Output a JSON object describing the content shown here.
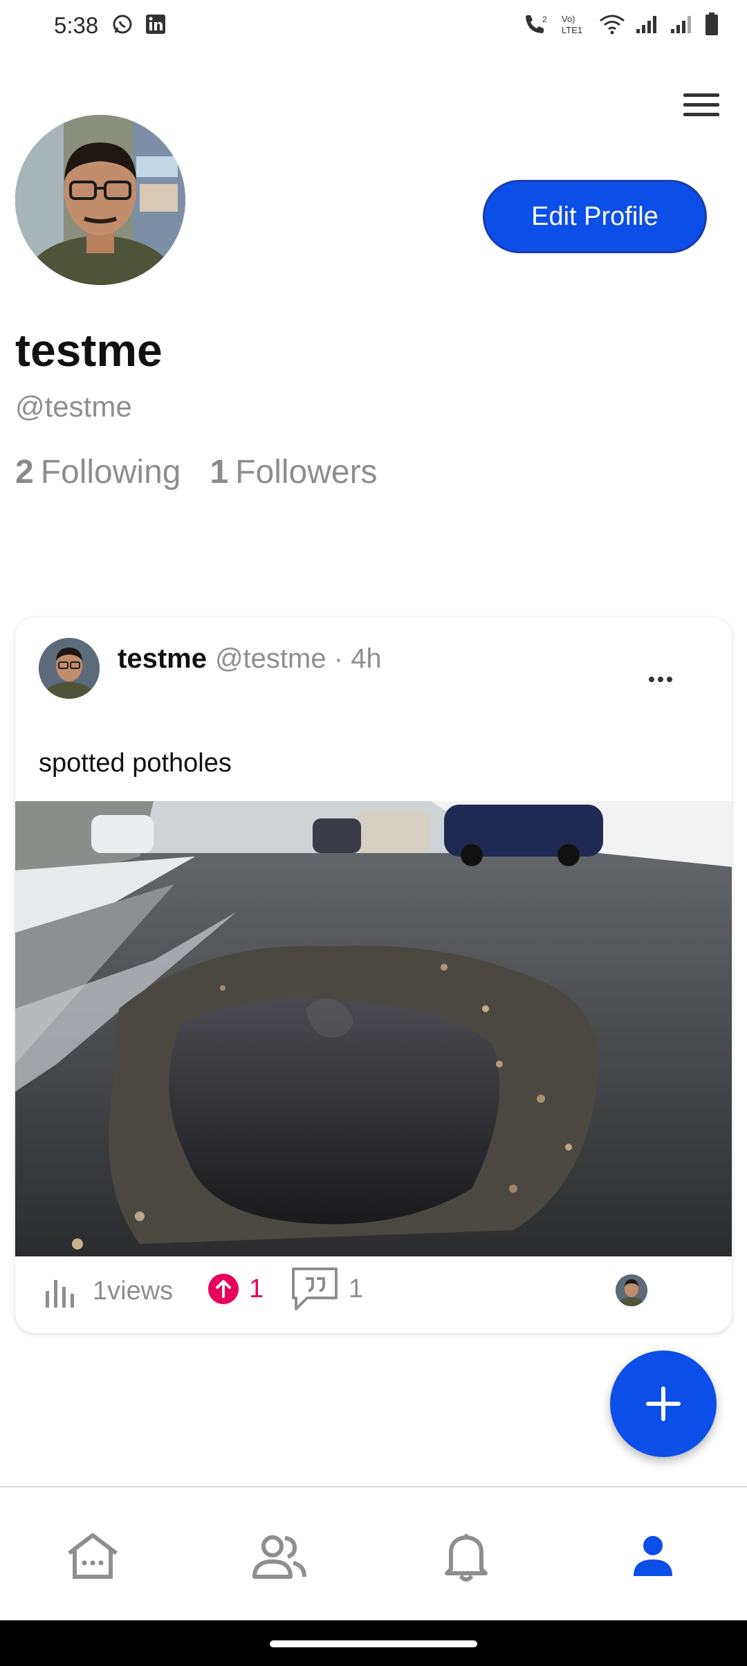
{
  "status_bar": {
    "time": "5:38",
    "left_icons": [
      "whatsapp-icon",
      "linkedin-icon"
    ],
    "right_icons": [
      "call-icon",
      "volte-icon",
      "wifi-icon",
      "signal-icon",
      "signal-icon",
      "battery-icon"
    ],
    "volte_text": "Vo) LTE1",
    "call_sub": "2"
  },
  "header": {
    "menu_icon": "hamburger-menu-icon"
  },
  "profile": {
    "display_name": "testme",
    "handle": "@testme",
    "edit_button_label": "Edit Profile",
    "following_count": "2",
    "following_label": "Following",
    "followers_count": "1",
    "followers_label": "Followers"
  },
  "post": {
    "author": "testme",
    "handle": "@testme",
    "separator": "·",
    "time": "4h",
    "text": "spotted potholes",
    "image_description": "pothole-photo",
    "views": "1",
    "views_label": "views",
    "upvotes": "1",
    "comments": "1"
  },
  "fab": {
    "icon": "plus-icon"
  },
  "bottom_nav": {
    "items": [
      "home-icon",
      "people-icon",
      "bell-icon",
      "profile-icon"
    ],
    "active": "profile-icon"
  },
  "colors": {
    "accent": "#0b4ee8",
    "upvote": "#e8005a",
    "muted": "#8e8e8e"
  }
}
